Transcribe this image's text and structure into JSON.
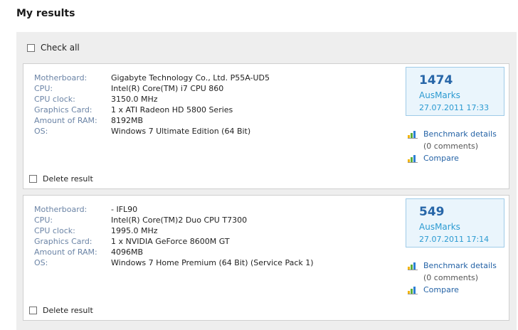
{
  "page": {
    "title": "My results",
    "check_all_label": "Check all"
  },
  "colors": {
    "label": "#6b84a6",
    "score": "#2766a8",
    "accent": "#2b9ad1",
    "link": "#2563a6"
  },
  "results": [
    {
      "specs": [
        {
          "label": "Motherboard:",
          "value": "Gigabyte Technology Co., Ltd. P55A-UD5"
        },
        {
          "label": "CPU:",
          "value": "Intel(R) Core(TM) i7 CPU 860"
        },
        {
          "label": "CPU clock:",
          "value": "3150.0 MHz"
        },
        {
          "label": "Graphics Card:",
          "value": "1 x ATI Radeon HD 5800 Series"
        },
        {
          "label": "Amount of RAM:",
          "value": "8192MB"
        },
        {
          "label": "OS:",
          "value": "Windows 7 Ultimate Edition (64 Bit)"
        }
      ],
      "score": "1474",
      "unit": "AusMarks",
      "date": "27.07.2011 17:33",
      "benchmark_link": "Benchmark details",
      "comments": "(0 comments)",
      "compare_link": "Compare",
      "delete_label": "Delete result"
    },
    {
      "specs": [
        {
          "label": "Motherboard:",
          "value": "- IFL90"
        },
        {
          "label": "CPU:",
          "value": "Intel(R) Core(TM)2 Duo CPU T7300"
        },
        {
          "label": "CPU clock:",
          "value": "1995.0 MHz"
        },
        {
          "label": "Graphics Card:",
          "value": "1 x NVIDIA GeForce 8600M GT"
        },
        {
          "label": "Amount of RAM:",
          "value": "4096MB"
        },
        {
          "label": "OS:",
          "value": "Windows 7 Home Premium (64 Bit) (Service Pack 1)"
        }
      ],
      "score": "549",
      "unit": "AusMarks",
      "date": "27.07.2011 17:14",
      "benchmark_link": "Benchmark details",
      "comments": "(0 comments)",
      "compare_link": "Compare",
      "delete_label": "Delete result"
    }
  ]
}
